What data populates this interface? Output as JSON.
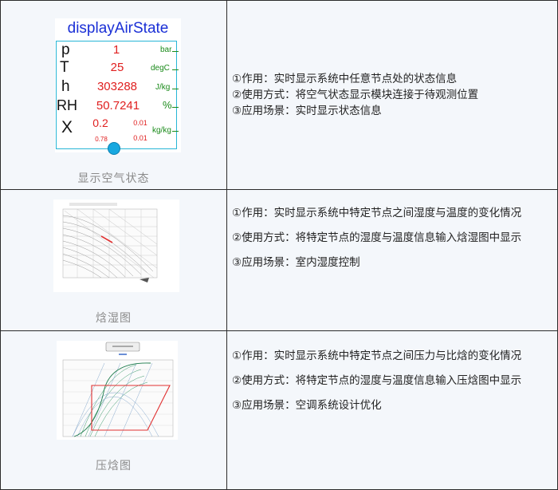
{
  "rows": [
    {
      "caption": "显示空气状态",
      "desc": [
        "①作用：实时显示系统中任意节点处的状态信息",
        "②使用方式：将空气状态显示模块连接于待观测位置",
        "③应用场景：实时显示状态信息"
      ],
      "widget": {
        "title": "displayAirState",
        "p": {
          "label": "p",
          "value": "1",
          "unit": "bar"
        },
        "T": {
          "label": "T",
          "value": "25",
          "unit": "degC"
        },
        "h": {
          "label": "h",
          "value": "303288",
          "unit": "J/kg"
        },
        "RH": {
          "label": "RH",
          "value": "50.7241",
          "unit": "%"
        },
        "X": {
          "label": "X",
          "v1": "0.2",
          "v2": "0.01",
          "v3": "0.78",
          "v4": "0.01",
          "unit": "kg/kg"
        }
      }
    },
    {
      "caption": "焓湿图",
      "desc": [
        "①作用：实时显示系统中特定节点之间湿度与温度的变化情况",
        "②使用方式：将特定节点的湿度与温度信息输入焓湿图中显示",
        "③应用场景：室内湿度控制"
      ]
    },
    {
      "caption": "压焓图",
      "desc": [
        "①作用：实时显示系统中特定节点之间压力与比焓的变化情况",
        "②使用方式：将特定节点的湿度与温度信息输入压焓图中显示",
        "③应用场景：空调系统设计优化"
      ]
    }
  ]
}
